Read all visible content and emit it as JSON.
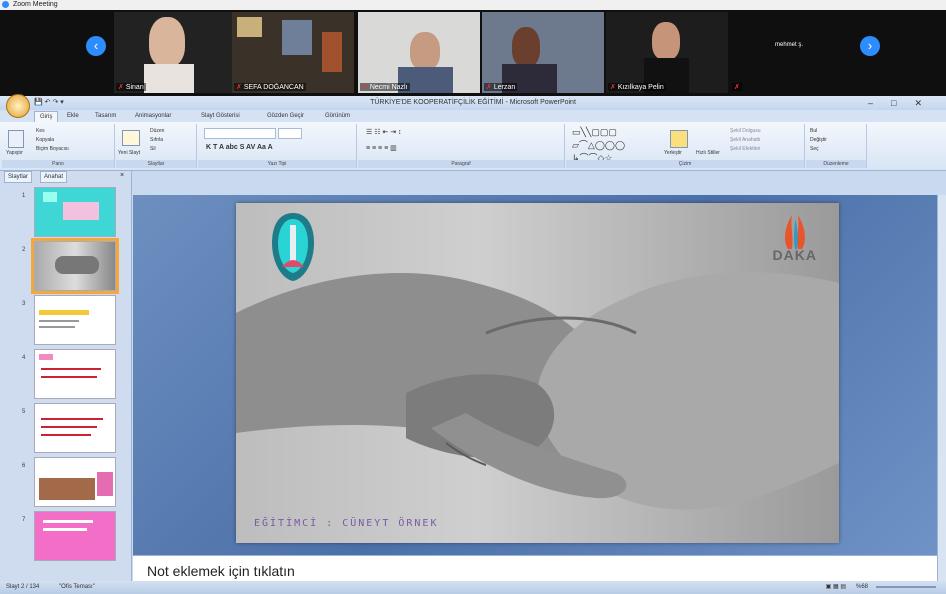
{
  "zoom": {
    "title": "Zoom Meeting",
    "participants": [
      {
        "name": "Sinan"
      },
      {
        "name": "SEFA DOĞANCAN"
      },
      {
        "name": "Necmi Nazlı"
      },
      {
        "name": "Lerzan"
      },
      {
        "name": "Kızılkaya Pelin"
      },
      {
        "name": "Mehmet ş."
      }
    ],
    "last_tile_label": "mehmet ş.",
    "accent": "#2d8cff"
  },
  "ppt": {
    "window_title": "TÜRKİYE'DE KOOPERATİFÇİLİK EĞİTİMİ - Microsoft PowerPoint",
    "window_controls": [
      "–",
      "□",
      "✕"
    ],
    "tabs": [
      "Giriş",
      "Ekle",
      "Tasarım",
      "Animasyonlar",
      "Slayt Gösterisi",
      "Gözden Geçir",
      "Görünüm"
    ],
    "ribbon_groups": [
      "Pano",
      "Slaytlar",
      "Yazı Tipi",
      "Paragraf",
      "Çizim",
      "Düzenleme"
    ],
    "ribbon_buttons": {
      "paste": "Yapıştır",
      "cut": "Kes",
      "copy": "Kopyala",
      "format_painter": "Biçim Boyacısı",
      "new_slide": "Yeni Slayt",
      "layout": "Düzen",
      "reset": "Sıfırla",
      "delete": "Sil",
      "arrange": "Yerleştir",
      "quick_styles": "Hızlı Stiller",
      "shape_fill": "Şekil Dolgusu",
      "shape_outline": "Şekil Anahattı",
      "shape_effects": "Şekil Efektleri",
      "find": "Bul",
      "replace": "Değiştir",
      "select": "Seç"
    },
    "pane_tabs": [
      "Slaytlar",
      "Anahat"
    ],
    "slide_numbers": [
      "1",
      "2",
      "3",
      "4",
      "5",
      "6",
      "7"
    ],
    "current_slide": {
      "credit": "EĞİTİMCİ : CÜNEYT ÖRNEK",
      "logo_text": "DAKA"
    },
    "notes_placeholder": "Not eklemek için tıklatın",
    "status": {
      "slide_info": "Slayt 2 / 134",
      "theme": "\"Ofis Teması\"",
      "zoom": "%68"
    }
  }
}
